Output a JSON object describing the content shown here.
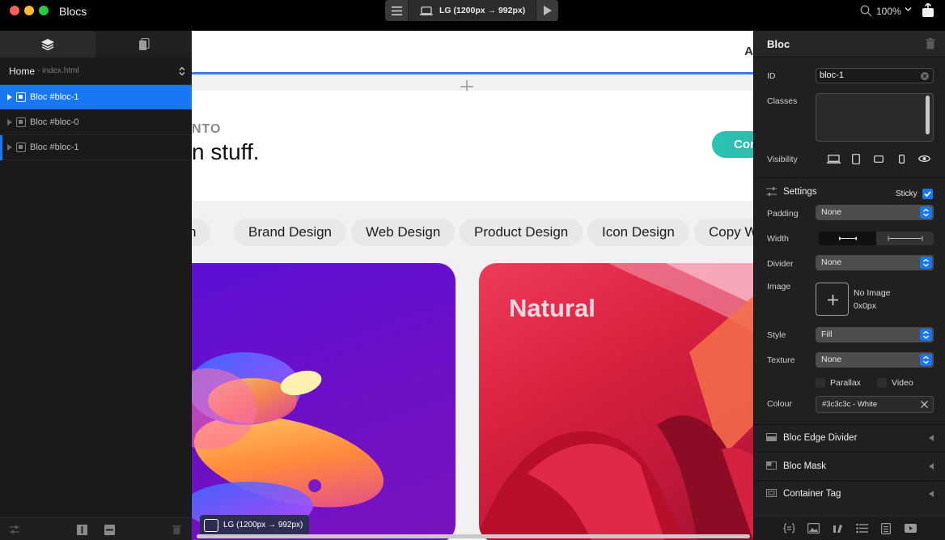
{
  "window": {
    "app_title": "Blocs",
    "breakpoint_label": "LG (1200px → 992px)",
    "zoom": "100%"
  },
  "left_panel": {
    "page_name": "Home",
    "page_file": "- index.html",
    "layers": [
      {
        "label": "Bloc #bloc-1",
        "selected": true
      },
      {
        "label": "Bloc #bloc-0",
        "selected": false
      },
      {
        "label": "Bloc #bloc-1",
        "selected": false
      }
    ]
  },
  "canvas": {
    "nav_letter": "A",
    "hero_small": "NTO",
    "hero_big": "n stuff.",
    "hero_button": "Cor",
    "pills": [
      "tion",
      "Brand Design",
      "Web Design",
      "Product Design",
      "Icon Design",
      "Copy W"
    ],
    "card_right_title": "Natural",
    "breakpoint_badge": "LG (1200px → 992px)"
  },
  "right_panel": {
    "title": "Bloc",
    "id_label": "ID",
    "id_value": "bloc-1",
    "classes_label": "Classes",
    "visibility_label": "Visibility",
    "settings_title": "Settings",
    "sticky_label": "Sticky",
    "padding_label": "Padding",
    "padding_value": "None",
    "width_label": "Width",
    "divider_label": "Divider",
    "divider_value": "None",
    "image_label": "Image",
    "image_text": "No Image",
    "image_size": "0x0px",
    "style_label": "Style",
    "style_value": "Fill",
    "texture_label": "Texture",
    "texture_value": "None",
    "parallax_label": "Parallax",
    "video_label": "Video",
    "colour_label": "Colour",
    "colour_value": "#3c3c3c - White",
    "sections": [
      "Bloc Edge Divider",
      "Bloc Mask",
      "Container Tag"
    ]
  },
  "colors": {
    "accent": "#1877f2",
    "hero_button": "#2ec0b0",
    "card_left": "#6a10c8",
    "card_right": "#d8203f"
  }
}
